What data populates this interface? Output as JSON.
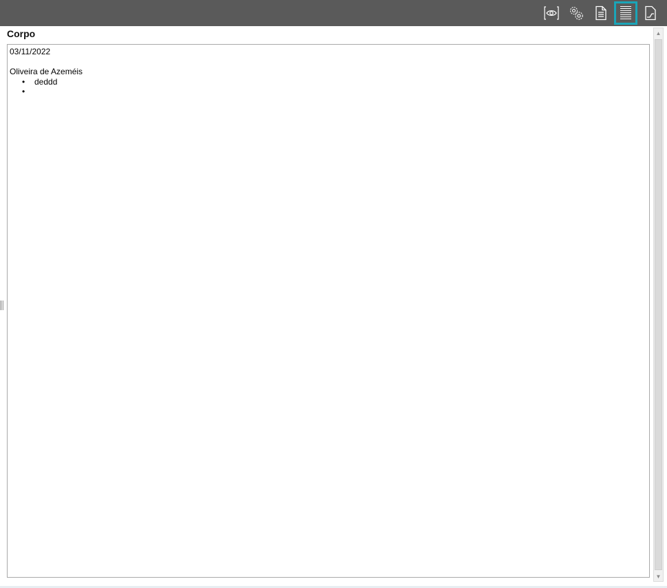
{
  "toolbar": {
    "background": "#5a5a5a",
    "active_outline": "#1aa5b8",
    "buttons": [
      {
        "icon": "eye-icon",
        "tooltip": "",
        "active": false
      },
      {
        "icon": "gears-icon",
        "tooltip": "",
        "active": false
      },
      {
        "icon": "document-icon",
        "tooltip": "",
        "active": false
      },
      {
        "icon": "body-lines-icon",
        "tooltip": "",
        "active": true
      },
      {
        "icon": "page-footer-icon",
        "tooltip": "",
        "active": false
      }
    ]
  },
  "section": {
    "title": "Corpo"
  },
  "editor": {
    "date_line": "03/11/2022",
    "location_line": "Oliveira de Azeméis",
    "bullets": [
      "deddd",
      ""
    ]
  }
}
